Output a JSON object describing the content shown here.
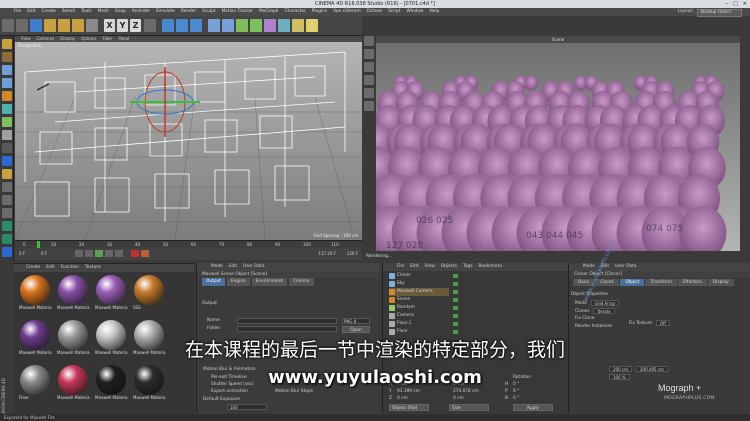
{
  "window": {
    "title": "CINEMA 4D R16.038 Studio (R16) - [0701.c4d *]",
    "controls": [
      "–",
      "□",
      "✕"
    ]
  },
  "menubar": {
    "items": [
      "File",
      "Edit",
      "Create",
      "Select",
      "Tools",
      "Mesh",
      "Snap",
      "Animate",
      "Simulate",
      "Render",
      "Sculpt",
      "Motion Tracker",
      "MoGraph",
      "Character",
      "Plugins",
      "Vue xStream",
      "Octane",
      "Script",
      "Window",
      "Help"
    ],
    "layout_label": "Layout:",
    "layout_value": "Startup (User)"
  },
  "toolbar": {
    "axis_x": "X",
    "axis_y": "Y",
    "axis_z": "Z"
  },
  "viewport": {
    "menu": [
      "View",
      "Cameras",
      "Display",
      "Options",
      "Filter",
      "Panel"
    ],
    "label": "Perspective",
    "grid_spacing": "Grid Spacing : 100 cm"
  },
  "timeline": {
    "ticks": [
      "0",
      "10",
      "20",
      "30",
      "40",
      "50",
      "60",
      "70",
      "80",
      "90",
      "100",
      "110"
    ],
    "frame_start": "0 F",
    "frame_field": "0 F",
    "frame_end": "117.20 F",
    "frame_end2": "120 F"
  },
  "render_view": {
    "title": "Scene",
    "status": "Rendering..."
  },
  "material_panel": {
    "menu": [
      "Create",
      "Edit",
      "Function",
      "Texture"
    ],
    "materials": [
      {
        "name": "Maxwell Material",
        "color": "#d9741e"
      },
      {
        "name": "Maxwell Material",
        "color": "#8b4fa8"
      },
      {
        "name": "Maxwell Material",
        "color": "#9a5fb8"
      },
      {
        "name": "SSS",
        "color": "#c77a2a"
      },
      {
        "name": "Maxwell Material",
        "color": "#6e3c90"
      },
      {
        "name": "Maxwell Material",
        "color": "#9c9c9c"
      },
      {
        "name": "Maxwell Material",
        "color": "#c9c9c9"
      },
      {
        "name": "Maxwell Material",
        "color": "#b0b0b0"
      },
      {
        "name": "Floor",
        "color": "#8a8a8a"
      },
      {
        "name": "Maxwell Material",
        "color": "#c8365a"
      },
      {
        "name": "Maxwell Material",
        "color": "#1f1f1f"
      },
      {
        "name": "Maxwell Material",
        "color": "#2b2b2b"
      }
    ],
    "vertical_label": "MAXON CINEMA 4D"
  },
  "scene_panel": {
    "menu": [
      "Mode",
      "Edit",
      "User Data"
    ],
    "title": "Maxwell Scene Object [Scene]",
    "tabs": [
      "Output",
      "Engine",
      "Environment",
      "Cinema"
    ],
    "section": "Output",
    "rows": [
      {
        "label": "Name"
      },
      {
        "label": "Folder"
      }
    ],
    "format_value": "PNG 8",
    "open_button": "Open",
    "sections": [
      {
        "label": "Motion Blur & Animation"
      },
      {
        "label": "Per-exit Timeline"
      },
      {
        "label": "Shutter Speed (sec)"
      },
      {
        "label": "Export animation"
      },
      {
        "label": "Default Exposure"
      }
    ],
    "motion_blur_label": "Motion Blur Steps",
    "iso_value": "100"
  },
  "object_panel": {
    "menu": [
      "File",
      "Edit",
      "View",
      "Objects",
      "Tags",
      "Bookmarks"
    ],
    "objects": [
      {
        "name": "Cloner",
        "color": "#7fb0e0"
      },
      {
        "name": "Sky",
        "color": "#7fb0e0"
      },
      {
        "name": "Maxwell Camera",
        "color": "#d08a2a"
      },
      {
        "name": "Scene",
        "color": "#d08a2a"
      },
      {
        "name": "Random",
        "color": "#8fcf6a"
      },
      {
        "name": "Camera",
        "color": "#aaaaaa"
      },
      {
        "name": "Floor.1",
        "color": "#aaaaaa"
      },
      {
        "name": "Floor",
        "color": "#aaaaaa"
      }
    ],
    "coord_headers": [
      "Position",
      "Size",
      "Rotation"
    ],
    "coords": [
      {
        "axis": "X",
        "pos": "0 cm",
        "size": "0 cm",
        "rot_label": "H",
        "rot": "0 °"
      },
      {
        "axis": "Y",
        "pos": "91.399 cm",
        "size": "274.078 cm",
        "rot_label": "P",
        "rot": "0 °"
      },
      {
        "axis": "Z",
        "pos": "0 cm",
        "size": "0 cm",
        "rot_label": "B",
        "rot": "0 °"
      }
    ],
    "object_select": "Object (Rel)",
    "size_select": "Size",
    "apply_button": "Apply"
  },
  "attr_panel": {
    "menu": [
      "Mode",
      "Edit",
      "User Data"
    ],
    "title": "Cloner Object [Cloner]",
    "tabs": [
      "Basic",
      "Coord.",
      "Object",
      "Transform",
      "Effectors",
      "Display"
    ],
    "section": "Object Properties",
    "rows": [
      {
        "label": "Mode",
        "value": "Grid Array"
      },
      {
        "label": "Clones",
        "value": "Iterate"
      },
      {
        "label": "Fix Clone",
        "value": ""
      },
      {
        "label": "Render Instances",
        "value": ""
      }
    ],
    "fix_texture_label": "Fix Texture",
    "fix_texture_value": "Off",
    "count_values": [
      "200 cm",
      "200.495 cm"
    ],
    "percent_label": "100 %"
  },
  "branding": {
    "mograph": "Mograph +",
    "mograph_sub": "MOGRAPHPLUS.COM"
  },
  "overlay": {
    "subtitle": "在本课程的最后一节中渲染的特定部分，我们",
    "watermark": "www.yuyulaoshi.com",
    "diagonal_watermark": "www.yuyulaoshi.com"
  },
  "status_bar": {
    "text": "Exported for Maxwell Fire"
  }
}
